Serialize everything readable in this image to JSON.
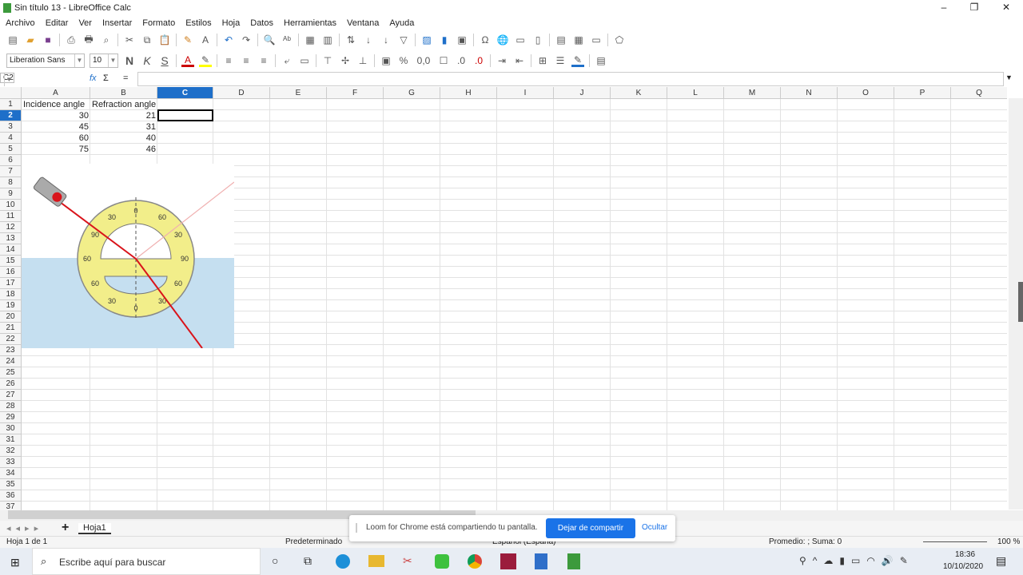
{
  "window": {
    "title": "Sin título 13 - LibreOffice Calc",
    "min": "–",
    "max": "❐",
    "close": "✕"
  },
  "menu": [
    "Archivo",
    "Editar",
    "Ver",
    "Insertar",
    "Formato",
    "Estilos",
    "Hoja",
    "Datos",
    "Herramientas",
    "Ventana",
    "Ayuda"
  ],
  "format": {
    "font": "Liberation Sans",
    "size": "10",
    "bold": "N",
    "italic": "K",
    "underline": "S",
    "percent": "%",
    "number": "0,0"
  },
  "formula": {
    "namebox": "C2",
    "fx": "fx",
    "sum": "Σ",
    "eq": "=",
    "value": ""
  },
  "columns": [
    "A",
    "B",
    "C",
    "D",
    "E",
    "F",
    "G",
    "H",
    "I",
    "J",
    "K",
    "L",
    "M",
    "N",
    "O",
    "P",
    "Q"
  ],
  "selected": {
    "col": "C",
    "row": 2
  },
  "cells": {
    "A1": "Incidence angle",
    "B1": "Refraction angle",
    "A2": "30",
    "B2": "21",
    "A3": "45",
    "B3": "31",
    "A4": "60",
    "B4": "40",
    "A5": "75",
    "B5": "46"
  },
  "figure": {
    "labels": [
      "30",
      "60",
      "90",
      "0",
      "30",
      "60",
      "90",
      "60",
      "30",
      "0",
      "60",
      "30"
    ],
    "colors": {
      "water": "#c5dff0",
      "protractor": "#f2ee8a",
      "laser": "#d9141b"
    }
  },
  "sheets": {
    "add": "+",
    "tabs": [
      "Hoja1"
    ]
  },
  "loom": {
    "message": "Loom for Chrome está compartiendo tu pantalla.",
    "stop": "Dejar de compartir",
    "hide": "Ocultar"
  },
  "status": {
    "sheet": "Hoja 1 de 1",
    "style": "Predeterminado",
    "lang": "Español (España)",
    "summary": "Promedio: ; Suma: 0",
    "zoom": "100 %"
  },
  "taskbar": {
    "search": "Escribe aquí para buscar",
    "time": "18:36",
    "date": "10/10/2020"
  }
}
